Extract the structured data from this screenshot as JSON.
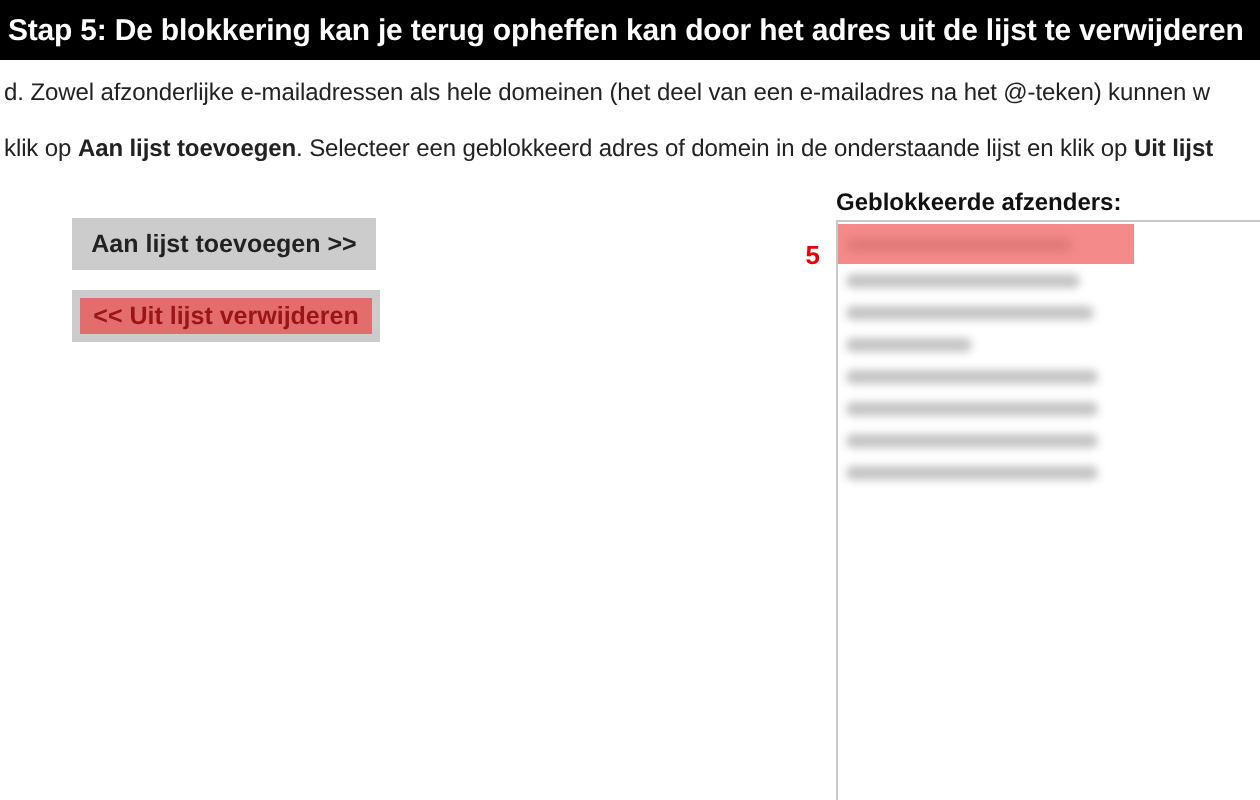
{
  "title": "Stap 5: De blokkering kan je terug opheffen kan door het adres uit de lijst te verwijderen",
  "paragraphs": [
    "d. Zowel afzonderlijke e-mailadressen als hele domeinen (het deel van een e-mailadres na het @-teken) kunnen w",
    "klik op **Aan lijst toevoegen**. Selecteer een geblokkeerd adres of domein in de onderstaande lijst en klik op **Uit lijst**"
  ],
  "buttons": [
    {
      "label": "Aan lijst toevoegen >>",
      "highlighted": false
    },
    {
      "label": "<< Uit lijst verwijderen",
      "highlighted": true
    }
  ],
  "list": {
    "title": "Geblokkeerde afzenders:",
    "callout": "5",
    "items": [
      {
        "selected": true
      },
      {
        "selected": false
      },
      {
        "selected": false
      },
      {
        "selected": false
      },
      {
        "selected": false
      },
      {
        "selected": false
      },
      {
        "selected": false
      },
      {
        "selected": false
      }
    ]
  }
}
